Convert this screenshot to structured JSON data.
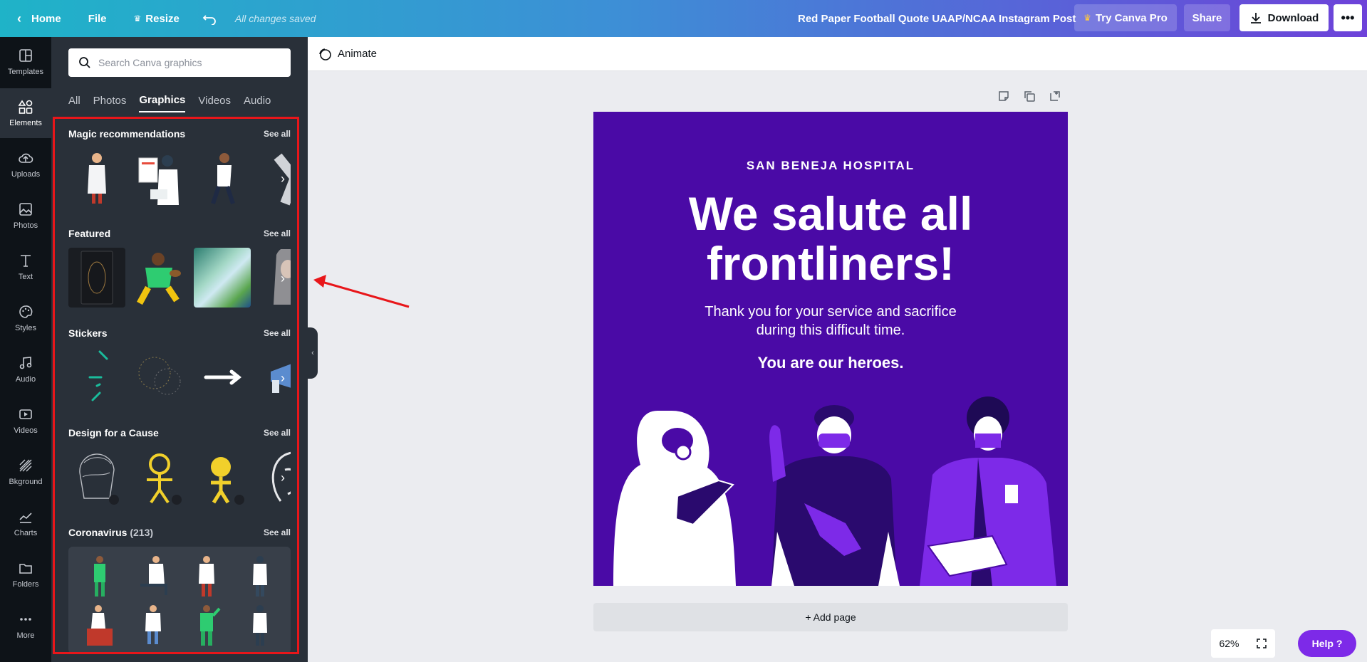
{
  "topbar": {
    "home": "Home",
    "file": "File",
    "resize": "Resize",
    "saved": "All changes saved",
    "title": "Red Paper Football Quote UAAP/NCAA Instagram Post",
    "try_pro": "Try Canva Pro",
    "share": "Share",
    "download": "Download",
    "more": "•••"
  },
  "rail": {
    "templates": "Templates",
    "elements": "Elements",
    "uploads": "Uploads",
    "photos": "Photos",
    "text": "Text",
    "styles": "Styles",
    "audio": "Audio",
    "videos": "Videos",
    "bkground": "Bkground",
    "charts": "Charts",
    "folders": "Folders",
    "more": "More"
  },
  "panel": {
    "search_placeholder": "Search Canva graphics",
    "tabs": [
      "All",
      "Photos",
      "Graphics",
      "Videos",
      "Audio"
    ],
    "see_all": "See all",
    "sections": {
      "magic": "Magic recommendations",
      "featured": "Featured",
      "stickers": "Stickers",
      "cause": "Design for a Cause",
      "corona": "Coronavirus",
      "corona_count": "(213)"
    }
  },
  "main": {
    "animate": "Animate",
    "add_page": "+ Add page",
    "zoom": "62%",
    "help": "Help ?"
  },
  "design": {
    "hospital": "SAN BENEJA HOSPITAL",
    "headline_1": "We salute all",
    "headline_2": "frontliners!",
    "body_1": "Thank you for your service and sacrifice",
    "body_2": "during this difficult time.",
    "heroes": "You are our heroes."
  },
  "colors": {
    "design_bg": "#4a0aa6",
    "accent": "#7d2ae8",
    "panel_bg": "#293039",
    "rail_bg": "#0e1318",
    "highlight": "#e8161a"
  }
}
